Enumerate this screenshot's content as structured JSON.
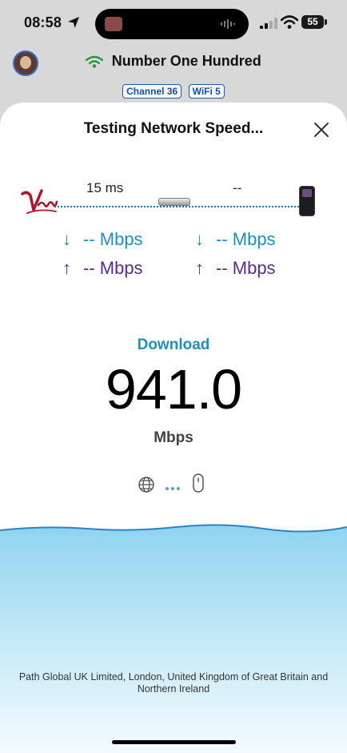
{
  "status_bar": {
    "time": "08:58",
    "battery": "55"
  },
  "network": {
    "name": "Number One Hundred",
    "tags": [
      "Channel 36",
      "WiFi 5"
    ]
  },
  "sheet": {
    "title": "Testing Network Speed...",
    "isp_name": "Virgin",
    "ping_isp": "15 ms",
    "ping_device": "--",
    "left_download": "-- Mbps",
    "left_upload": "-- Mbps",
    "right_download": "-- Mbps",
    "right_upload": "-- Mbps",
    "down_arrow": "↓",
    "up_arrow": "↑",
    "metric_label": "Download",
    "metric_value": "941.0",
    "metric_unit": "Mbps",
    "footer": "Path Global UK Limited, London, United Kingdom of Great Britain and Northern Ireland"
  },
  "colors": {
    "download": "#1f8fbf",
    "upload": "#5b2a8f",
    "water": "#8fd3ef",
    "isp_logo": "#b2142d"
  },
  "icons": {
    "location": "location-arrow-icon",
    "signal": "cellular-signal-icon",
    "wifi": "wifi-icon",
    "close": "close-icon",
    "globe": "globe-icon",
    "server": "server-icon",
    "router": "router-icon",
    "phone": "phone-icon"
  }
}
